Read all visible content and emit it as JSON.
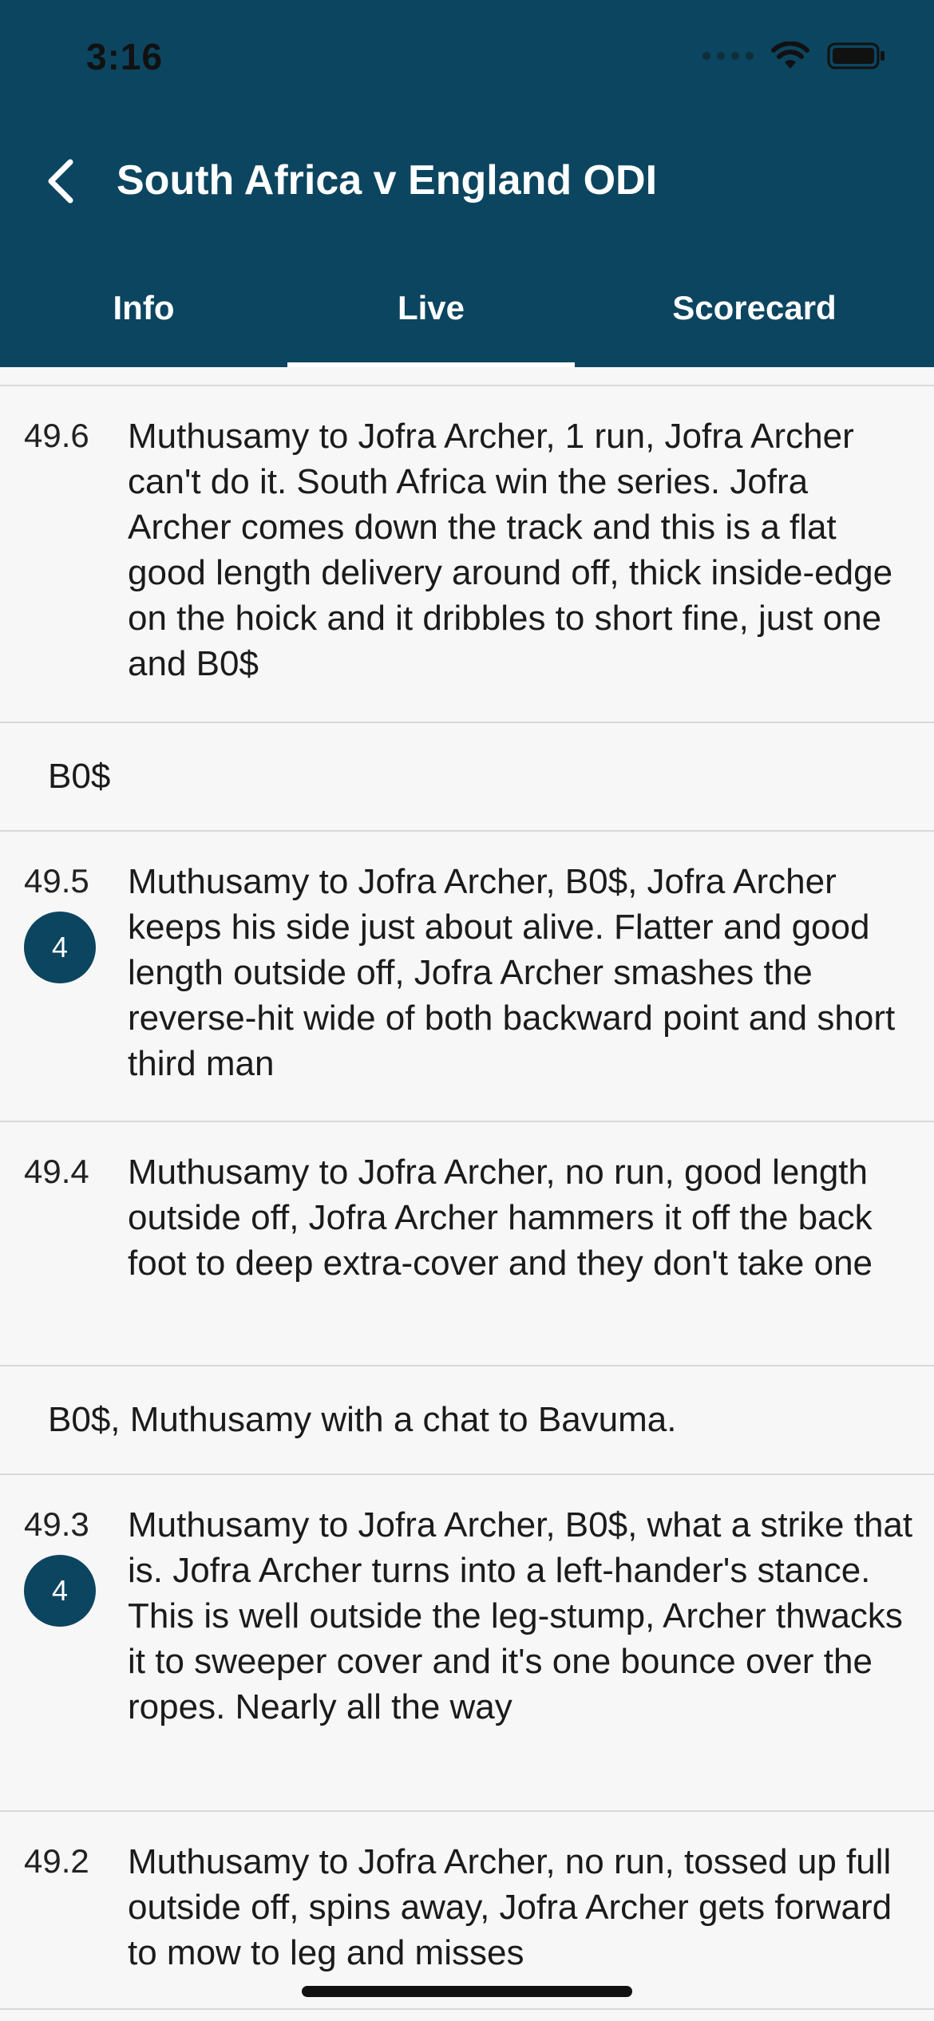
{
  "status_bar": {
    "time": "3:16"
  },
  "header": {
    "title": "South Africa v England ODI"
  },
  "tabs": [
    {
      "label": "Info",
      "active": false
    },
    {
      "label": "Live",
      "active": true
    },
    {
      "label": "Scorecard",
      "active": false
    }
  ],
  "feed": {
    "items": [
      {
        "over": "49.6",
        "runs_badge": null,
        "text": "Muthusamy to Jofra Archer, 1 run, Jofra Archer can't do it. South Africa win the series. Jofra Archer comes down the track and this is a flat good length delivery around off, thick inside-edge on the hoick and it dribbles to short fine, just one and B0$"
      },
      {
        "note": "B0$"
      },
      {
        "over": "49.5",
        "runs_badge": "4",
        "text": "Muthusamy to Jofra Archer, B0$, Jofra Archer keeps his side just about alive. Flatter and good length outside off, Jofra Archer smashes the reverse-hit wide of both backward point and short third man"
      },
      {
        "over": "49.4",
        "runs_badge": null,
        "text": "Muthusamy to Jofra Archer, no run, good length outside off, Jofra Archer hammers it off the back foot to deep extra-cover and they don't take one"
      },
      {
        "note": "B0$, Muthusamy with a chat to Bavuma."
      },
      {
        "over": "49.3",
        "runs_badge": "4",
        "text": "Muthusamy to Jofra Archer, B0$, what a strike that is. Jofra Archer turns into a left-hander's stance. This is well outside the leg-stump, Archer thwacks it to sweeper cover and it's one bounce over the ropes. Nearly all the way"
      },
      {
        "over": "49.2",
        "runs_badge": null,
        "text": "Muthusamy to Jofra Archer, no run, tossed up full outside off, spins away, Jofra Archer gets forward to mow to leg and misses"
      }
    ]
  },
  "colors": {
    "header_bg": "#0c4560",
    "badge_bg": "#0c4560",
    "page_bg": "#f7f7f7"
  }
}
